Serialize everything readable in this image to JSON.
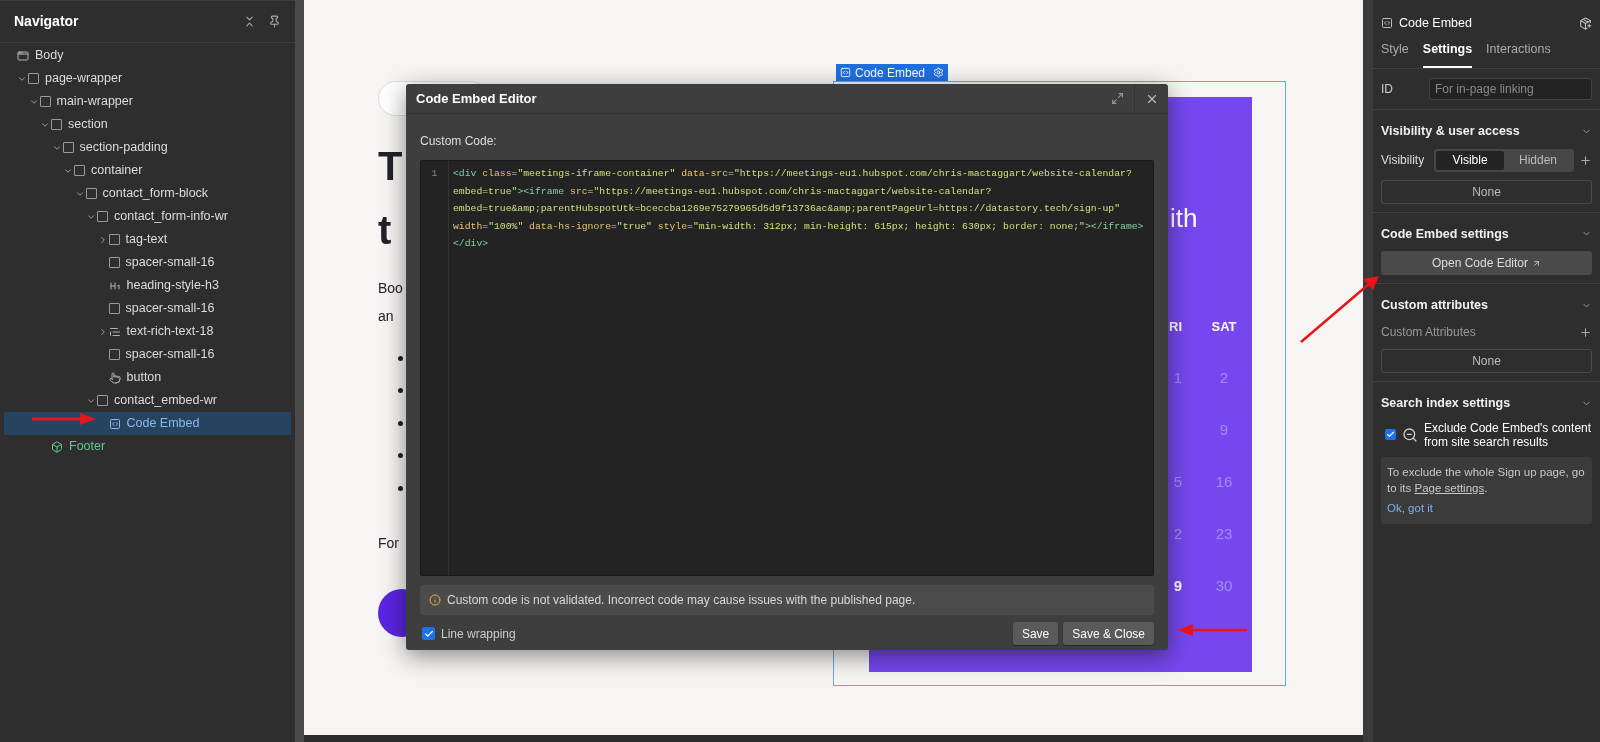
{
  "navigator": {
    "title": "Navigator",
    "items": [
      {
        "label": "Body",
        "kind": "body",
        "selected": false,
        "children": [
          {
            "label": "page-wrapper",
            "kind": "box",
            "expanded": true,
            "selected": false,
            "children": [
              {
                "label": "main-wrapper",
                "kind": "box",
                "expanded": true,
                "selected": false,
                "children": [
                  {
                    "label": "section",
                    "kind": "box",
                    "expanded": true,
                    "selected": false,
                    "children": [
                      {
                        "label": "section-padding",
                        "kind": "box",
                        "expanded": true,
                        "selected": false,
                        "children": [
                          {
                            "label": "container",
                            "kind": "box",
                            "expanded": true,
                            "selected": false,
                            "children": [
                              {
                                "label": "contact_form-block",
                                "kind": "box",
                                "expanded": true,
                                "selected": false,
                                "children": [
                                  {
                                    "label": "contact_form-info-wr",
                                    "kind": "box",
                                    "expanded": true,
                                    "selected": false,
                                    "children": [
                                      {
                                        "label": "tag-text",
                                        "kind": "box",
                                        "expanded": false,
                                        "selected": false
                                      },
                                      {
                                        "label": "spacer-small-16",
                                        "kind": "box",
                                        "selected": false
                                      },
                                      {
                                        "label": "heading-style-h3",
                                        "kind": "heading",
                                        "selected": false
                                      },
                                      {
                                        "label": "spacer-small-16",
                                        "kind": "box",
                                        "selected": false
                                      },
                                      {
                                        "label": "text-rich-text-18",
                                        "kind": "richtext",
                                        "expanded": false,
                                        "selected": false
                                      },
                                      {
                                        "label": "spacer-small-16",
                                        "kind": "box",
                                        "selected": false
                                      },
                                      {
                                        "label": "button",
                                        "kind": "button",
                                        "selected": false
                                      }
                                    ]
                                  },
                                  {
                                    "label": "contact_embed-wr",
                                    "kind": "box",
                                    "expanded": true,
                                    "selected": false,
                                    "children": [
                                      {
                                        "label": "Code Embed",
                                        "kind": "embed",
                                        "selected": true
                                      }
                                    ]
                                  }
                                ]
                              }
                            ]
                          }
                        ]
                      }
                    ]
                  },
                  {
                    "label": "Footer",
                    "kind": "component",
                    "selected": false
                  }
                ]
              }
            ]
          }
        ]
      }
    ]
  },
  "canvas": {
    "selection_label": "Code Embed",
    "heading_lines": [
      "T",
      "t"
    ],
    "paragraph_lines": [
      "Boo",
      "an"
    ],
    "list_items": [
      {
        "kind": "bullet"
      },
      {
        "kind": "bullet"
      },
      {
        "kind": "bullet"
      },
      {
        "kind": "bullet"
      },
      {
        "kind": "bullet"
      }
    ],
    "closing_line": "For",
    "calendar": {
      "title_fragment": "ith",
      "weekdays": [
        "RI",
        "SAT"
      ],
      "rows": [
        {
          "left": {
            "text": "1",
            "available": false
          },
          "right": {
            "text": "2",
            "available": false
          }
        },
        {
          "right": {
            "text": "9",
            "available": false
          }
        },
        {
          "left": {
            "text": "5",
            "available": false
          },
          "right": {
            "text": "16",
            "available": false
          }
        },
        {
          "left": {
            "text": "2",
            "available": false
          },
          "right": {
            "text": "23",
            "available": false
          }
        },
        {
          "left": {
            "text": "9",
            "available": true
          },
          "right": {
            "text": "30",
            "available": false
          }
        }
      ]
    }
  },
  "dialog": {
    "title": "Code Embed Editor",
    "field_label": "Custom Code:",
    "line_numbers": [
      "1"
    ],
    "code": [
      {
        "kind": "tag",
        "text": "<div"
      },
      {
        "kind": "attr",
        "text": " class"
      },
      {
        "kind": "punct",
        "text": "="
      },
      {
        "kind": "value",
        "text": "\"meetings-iframe-container\""
      },
      {
        "kind": "attr",
        "text": " data-src"
      },
      {
        "kind": "punct",
        "text": "="
      },
      {
        "kind": "value",
        "text": "\"https://meetings-eu1.hubspot.com/chris-mactaggart/website-calendar?embed=true\""
      },
      {
        "kind": "tag",
        "text": "><iframe"
      },
      {
        "kind": "attr",
        "text": " src"
      },
      {
        "kind": "punct",
        "text": "="
      },
      {
        "kind": "value",
        "text": "\"https://meetings-eu1.hubspot.com/chris-mactaggart/website-calendar?embed=true&amp;parentHubspotUtk=bceccba1269e75279965d5d9f13736ac&amp;parentPageUrl=https://datastory.tech/sign-up\""
      },
      {
        "kind": "attr",
        "text": " width"
      },
      {
        "kind": "punct",
        "text": "="
      },
      {
        "kind": "value",
        "text": "\"100%\""
      },
      {
        "kind": "attr",
        "text": " data-hs-ignore"
      },
      {
        "kind": "punct",
        "text": "="
      },
      {
        "kind": "value",
        "text": "\"true\""
      },
      {
        "kind": "attr",
        "text": " style"
      },
      {
        "kind": "punct",
        "text": "="
      },
      {
        "kind": "value",
        "text": "\"min-width: 312px; min-height: 615px; height: 630px; border: none;\""
      },
      {
        "kind": "tag",
        "text": "></iframe></div>"
      }
    ],
    "warning": "Custom code is not validated. Incorrect code may cause issues with the published page.",
    "line_wrapping": {
      "label": "Line wrapping",
      "checked": true
    },
    "buttons": [
      "Save",
      "Save & Close"
    ]
  },
  "inspector": {
    "title": "Code Embed",
    "tabs": [
      {
        "label": "Style",
        "selected": false
      },
      {
        "label": "Settings",
        "selected": true
      },
      {
        "label": "Interactions",
        "selected": false
      }
    ],
    "id_field": {
      "label": "ID",
      "placeholder": "For in-page linking"
    },
    "visibility_section": {
      "title": "Visibility & user access",
      "label": "Visibility",
      "options": [
        {
          "label": "Visible",
          "selected": true
        },
        {
          "label": "Hidden",
          "selected": false
        }
      ],
      "conditions": "None"
    },
    "embed_section": {
      "title": "Code Embed settings",
      "button": "Open Code Editor"
    },
    "attributes_section": {
      "title": "Custom attributes",
      "label": "Custom Attributes",
      "value": "None"
    },
    "search_section": {
      "title": "Search index settings",
      "exclude": {
        "label": "Exclude Code Embed's content from site search results",
        "checked": true
      },
      "notice": "To exclude the whole Sign up page, go to its ",
      "notice_link": "Page settings",
      "notice_end": ".",
      "dismiss": "Ok, got it"
    }
  }
}
